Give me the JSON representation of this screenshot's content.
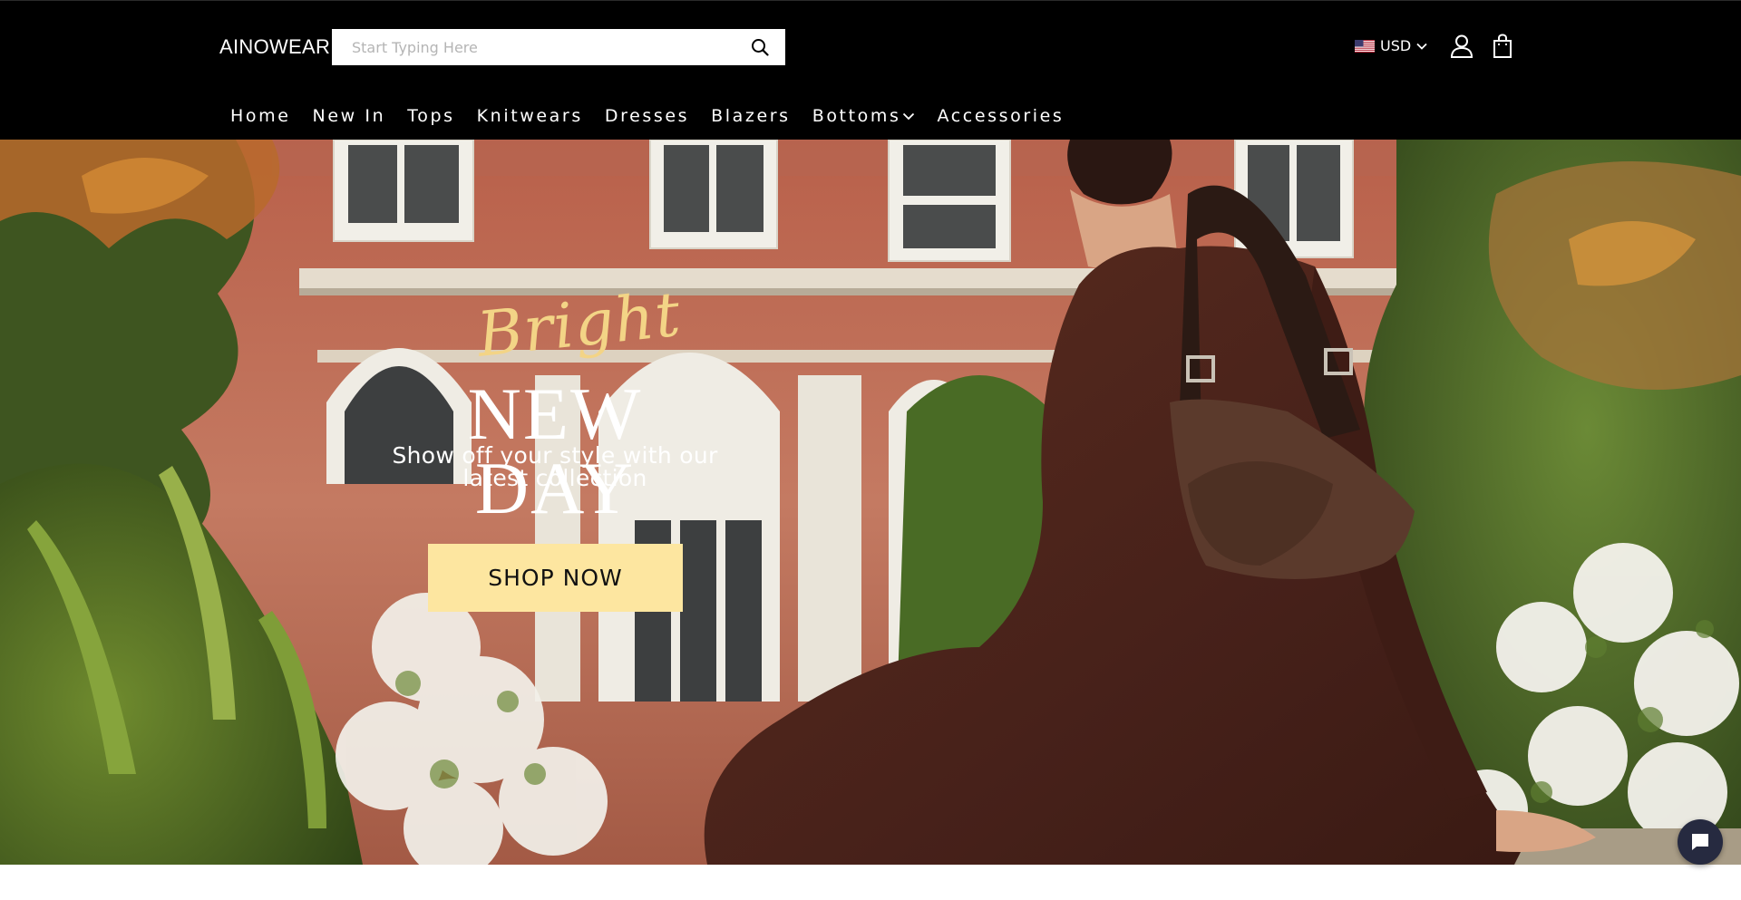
{
  "header": {
    "logo": "AINOWEAR",
    "search": {
      "placeholder": "Start Typing Here",
      "value": ""
    },
    "currency": {
      "label": "USD",
      "flag": "us-flag-icon"
    },
    "icons": [
      "search-icon",
      "user-icon",
      "shopping-bag-icon",
      "chevron-down-icon"
    ]
  },
  "nav": {
    "items": [
      {
        "label": "Home"
      },
      {
        "label": "New In"
      },
      {
        "label": "Tops"
      },
      {
        "label": "Knitwears"
      },
      {
        "label": "Dresses"
      },
      {
        "label": "Blazers"
      },
      {
        "label": "Bottoms",
        "has_dropdown": true
      },
      {
        "label": "Accessories"
      }
    ]
  },
  "hero": {
    "script_word": "Bright",
    "headline": "NEW DAY",
    "subline_1": "Show off your style with our",
    "subline_2": "latest collection",
    "cta": "SHOP NOW"
  },
  "chat": {
    "icon": "chat-icon"
  },
  "colors": {
    "header_bg": "#000000",
    "script_gold": "#f3d486",
    "cta_bg": "#fde6a0",
    "dress_brown": "#4a2318",
    "chat_bg": "#262a40"
  }
}
